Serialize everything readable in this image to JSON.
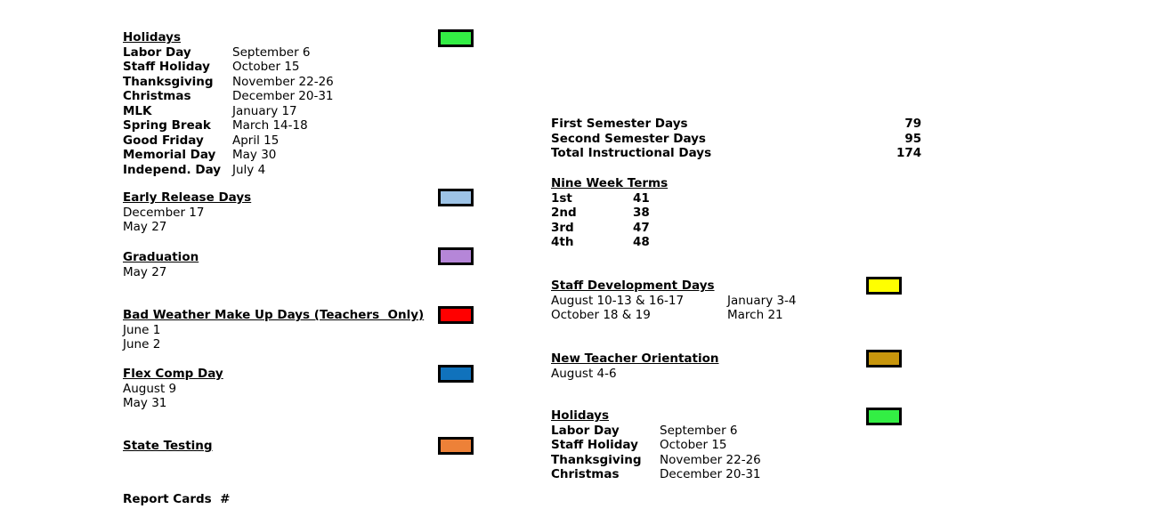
{
  "left_column": {
    "holidays": {
      "heading": "Holidays",
      "swatch_color": "#33EE44",
      "rows": [
        {
          "label": "Labor Day",
          "date": "September 6"
        },
        {
          "label": "Staff Holiday",
          "date": "October 15"
        },
        {
          "label": "Thanksgiving",
          "date": "November 22-26"
        },
        {
          "label": "Christmas",
          "date": "December 20-31"
        },
        {
          "label": "MLK",
          "date": "January 17"
        },
        {
          "label": "Spring Break",
          "date": "March 14-18"
        },
        {
          "label": "Good Friday",
          "date": "April 15"
        },
        {
          "label": "Memorial Day",
          "date": "May 30"
        },
        {
          "label": "Independ. Day",
          "date": "July 4"
        }
      ]
    },
    "early_release": {
      "heading": "Early Release Days",
      "swatch_color": "#9DC3E6",
      "dates": [
        "December 17",
        "May 27"
      ]
    },
    "graduation": {
      "heading": "Graduation",
      "swatch_color": "#B586D8",
      "dates": [
        "May 27"
      ]
    },
    "bad_weather": {
      "heading": "Bad Weather Make Up Days (Teachers  Only)",
      "swatch_color": "#FF0000",
      "dates": [
        "June 1",
        "June 2"
      ]
    },
    "flex_comp": {
      "heading": "Flex Comp Day",
      "swatch_color": "#1072BC",
      "dates": [
        "August 9",
        "May 31"
      ]
    },
    "state_testing": {
      "heading": "State Testing",
      "swatch_color": "#ED8138",
      "dates": []
    },
    "report_cards": {
      "heading": "Report Cards  #"
    }
  },
  "right_column": {
    "day_counts": [
      {
        "label": "First Semester Days",
        "value": "79"
      },
      {
        "label": "Second Semester Days",
        "value": "95"
      },
      {
        "label": "Total Instructional Days",
        "value": "174"
      }
    ],
    "nine_week_terms": {
      "heading": "Nine Week Terms",
      "rows": [
        {
          "label": "1st",
          "value": "41"
        },
        {
          "label": "2nd",
          "value": "38"
        },
        {
          "label": "3rd",
          "value": "47"
        },
        {
          "label": "4th",
          "value": "48"
        }
      ]
    },
    "staff_development": {
      "heading": "Staff Development Days",
      "swatch_color": "#FFFF00",
      "rows": [
        {
          "col1": "August 10-13 & 16-17",
          "col2": "January 3-4"
        },
        {
          "col1": "October 18 & 19",
          "col2": "March 21"
        }
      ]
    },
    "new_teacher_orientation": {
      "heading": "New Teacher Orientation",
      "swatch_color": "#C8960C",
      "dates": [
        "August 4-6"
      ]
    },
    "holidays": {
      "heading": "Holidays",
      "swatch_color": "#33EE44",
      "rows": [
        {
          "label": "Labor Day",
          "date": "September 6"
        },
        {
          "label": "Staff Holiday",
          "date": "October 15"
        },
        {
          "label": "Thanksgiving",
          "date": "November 22-26"
        },
        {
          "label": "Christmas",
          "date": "December 20-31"
        }
      ]
    }
  }
}
